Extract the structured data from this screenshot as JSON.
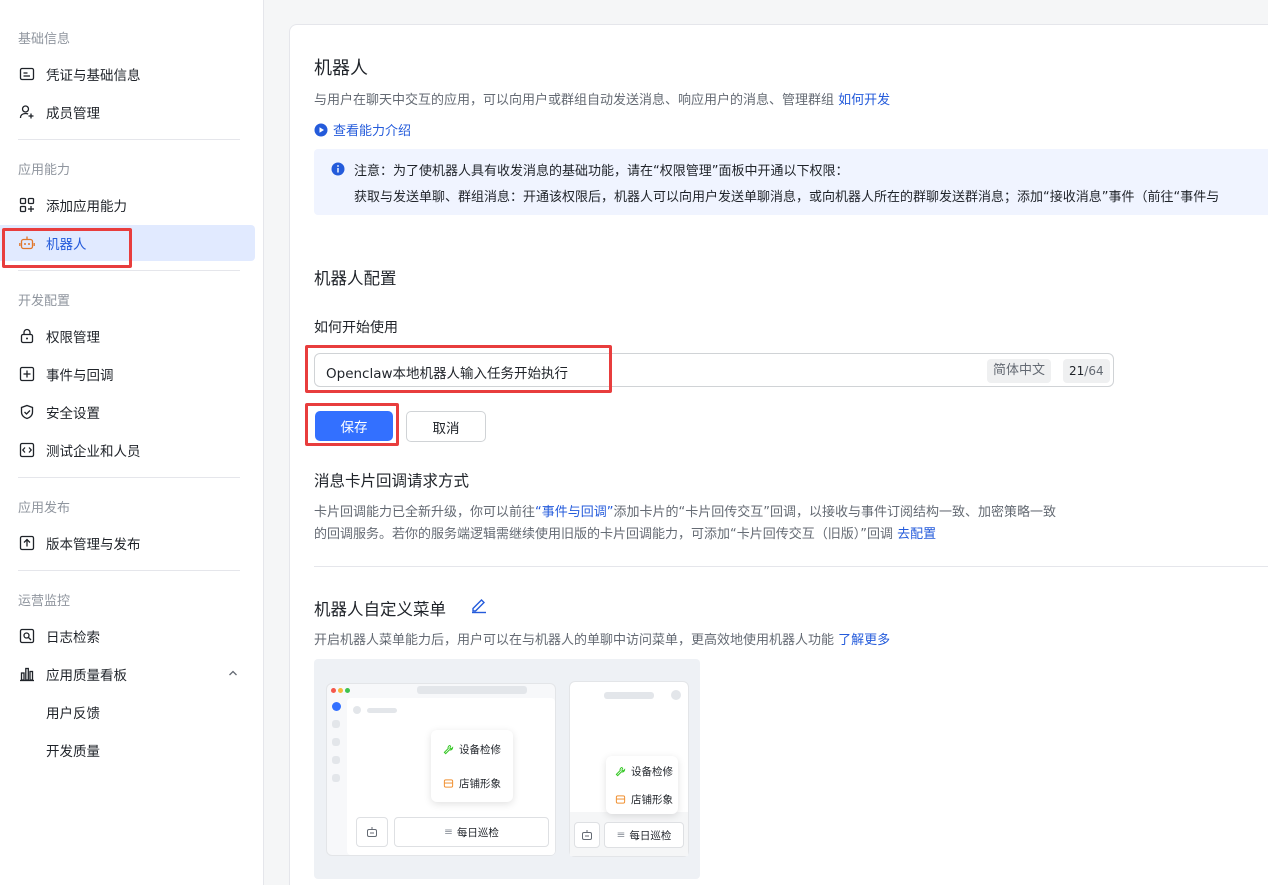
{
  "sidebar": {
    "sections": [
      {
        "title": "基础信息",
        "items": [
          {
            "label": "凭证与基础信息",
            "icon": "id-card-icon"
          },
          {
            "label": "成员管理",
            "icon": "add-user-icon"
          }
        ]
      },
      {
        "title": "应用能力",
        "items": [
          {
            "label": "添加应用能力",
            "icon": "apps-add-icon"
          },
          {
            "label": "机器人",
            "icon": "robot-icon",
            "active": true
          }
        ]
      },
      {
        "title": "开发配置",
        "items": [
          {
            "label": "权限管理",
            "icon": "lock-icon"
          },
          {
            "label": "事件与回调",
            "icon": "plus-square-icon"
          },
          {
            "label": "安全设置",
            "icon": "shield-icon"
          },
          {
            "label": "测试企业和人员",
            "icon": "code-icon"
          }
        ]
      },
      {
        "title": "应用发布",
        "items": [
          {
            "label": "版本管理与发布",
            "icon": "upload-icon"
          }
        ]
      },
      {
        "title": "运营监控",
        "items": [
          {
            "label": "日志检索",
            "icon": "log-search-icon"
          },
          {
            "label": "应用质量看板",
            "icon": "bar-chart-icon"
          },
          {
            "label": "用户反馈"
          },
          {
            "label": "开发质量"
          }
        ]
      }
    ]
  },
  "main": {
    "title": "机器人",
    "description": "与用户在聊天中交互的应用，可以向用户或群组自动发送消息、响应用户的消息、管理群组",
    "description_link": "如何开发",
    "capability_link": "查看能力介绍",
    "notice": {
      "line1": "注意：为了使机器人具有收发消息的基础功能，请在“权限管理”面板中开通以下权限：",
      "line2": "获取与发送单聊、群组消息：开通该权限后，机器人可以向用户发送单聊消息，或向机器人所在的群聊发送群消息；添加“接收消息”事件（前往“事件与"
    },
    "config_title": "机器人配置",
    "how_to_label": "如何开始使用",
    "input": {
      "value": "Openclaw本地机器人输入任务开始执行",
      "lang": "简体中文",
      "count_current": "21",
      "count_max": "/64"
    },
    "save_label": "保存",
    "cancel_label": "取消",
    "callback": {
      "title": "消息卡片回调请求方式",
      "p1_a": "卡片回调能力已全新升级，你可以前往",
      "p1_link": "“事件与回调”",
      "p1_b": "添加卡片的“卡片回传交互”回调，以接收与事件订阅结构一致、加密策略一致",
      "p2": "的回调服务。若你的服务端逻辑需继续使用旧版的卡片回调能力，可添加“卡片回传交互（旧版）”回调",
      "p2_link": "去配置"
    },
    "menu_section": {
      "title": "机器人自定义菜单",
      "description": "开启机器人菜单能力后，用户可以在与机器人的单聊中访问菜单，更高效地使用机器人功能",
      "learn_more": "了解更多"
    },
    "illustration": {
      "menu_items": [
        "设备检修",
        "店铺形象"
      ],
      "bottom_button": "每日巡检"
    }
  },
  "colors": {
    "primary": "#3370ff",
    "link": "#245bdb",
    "active_bg": "#e1eaff",
    "highlight_box": "#e83d3d",
    "notice_bg": "#f0f4ff"
  }
}
